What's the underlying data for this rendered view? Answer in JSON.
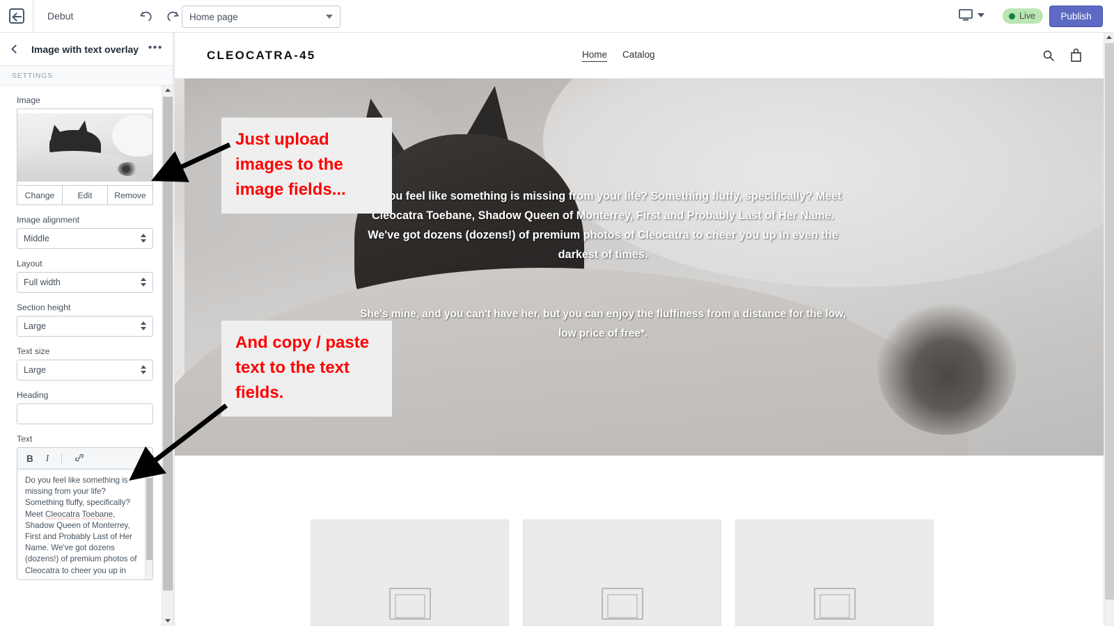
{
  "topbar": {
    "back_icon": "back-arrow-icon",
    "theme_name": "Debut",
    "undo_icon": "undo-icon",
    "redo_icon": "redo-icon",
    "page_select_value": "Home page",
    "device_icon": "desktop-icon",
    "live_label": "Live",
    "publish_label": "Publish",
    "publish_color": "#5c6ac4",
    "live_color": "#bbe5b3"
  },
  "sidebar": {
    "back_chevron_icon": "chevron-left-icon",
    "panel_title": "Image with text overlay",
    "more_icon": "ellipsis-icon",
    "section_label": "SETTINGS",
    "image": {
      "label": "Image",
      "thumbnail_alt": "black cat on white bedding",
      "actions": [
        "Change",
        "Edit",
        "Remove"
      ]
    },
    "fields": [
      {
        "label": "Image alignment",
        "value": "Middle"
      },
      {
        "label": "Layout",
        "value": "Full width"
      },
      {
        "label": "Section height",
        "value": "Large"
      },
      {
        "label": "Text size",
        "value": "Large"
      }
    ],
    "heading": {
      "label": "Heading",
      "value": "",
      "placeholder": ""
    },
    "text": {
      "label": "Text",
      "toolbar": {
        "bold": "B",
        "italic": "I",
        "link_icon": "link-icon"
      },
      "value": "Do you feel like something is missing from your life? Something fluffy, specifically? Meet Cleocatra Toebane, Shadow Queen of Monterrey, First and Probably Last of Her Name. We've got dozens (dozens!) of premium photos of Cleocatra to cheer you up in",
      "lines": [
        "Do you feel like something is",
        "missing from your life?",
        "Something fluffy, specifically?",
        "Meet Cleocatra Toebane,",
        "Shadow Queen of Monterrey,",
        "First and Probably Last of Her",
        "Name. We've got dozens",
        "(dozens!) of premium photos of",
        "Cleocatra to cheer you up in"
      ]
    }
  },
  "preview": {
    "store_name": "CLEOCATRA-45",
    "nav": [
      {
        "label": "Home",
        "active": true
      },
      {
        "label": "Catalog",
        "active": false
      }
    ],
    "search_icon": "search-icon",
    "cart_icon": "cart-icon",
    "hero": {
      "paragraph_1": "Do you feel like something is missing from your life? Something fluffy, specifically? Meet Cleocatra Toebane, Shadow Queen of Monterrey, First and Probably Last of Her Name. We've got dozens (dozens!) of premium photos of Cleocatra to cheer you up in even the darkest of times.",
      "paragraph_2": "She's mine, and you can't have her, but you can enjoy the fluffiness from a distance for the low, low price of free*."
    },
    "product_cards": 3
  },
  "annotations": [
    {
      "text": "Just upload images to the image fields...",
      "color": "#fe0000"
    },
    {
      "text": "And copy / paste text to the text fields.",
      "color": "#fe0000"
    }
  ]
}
